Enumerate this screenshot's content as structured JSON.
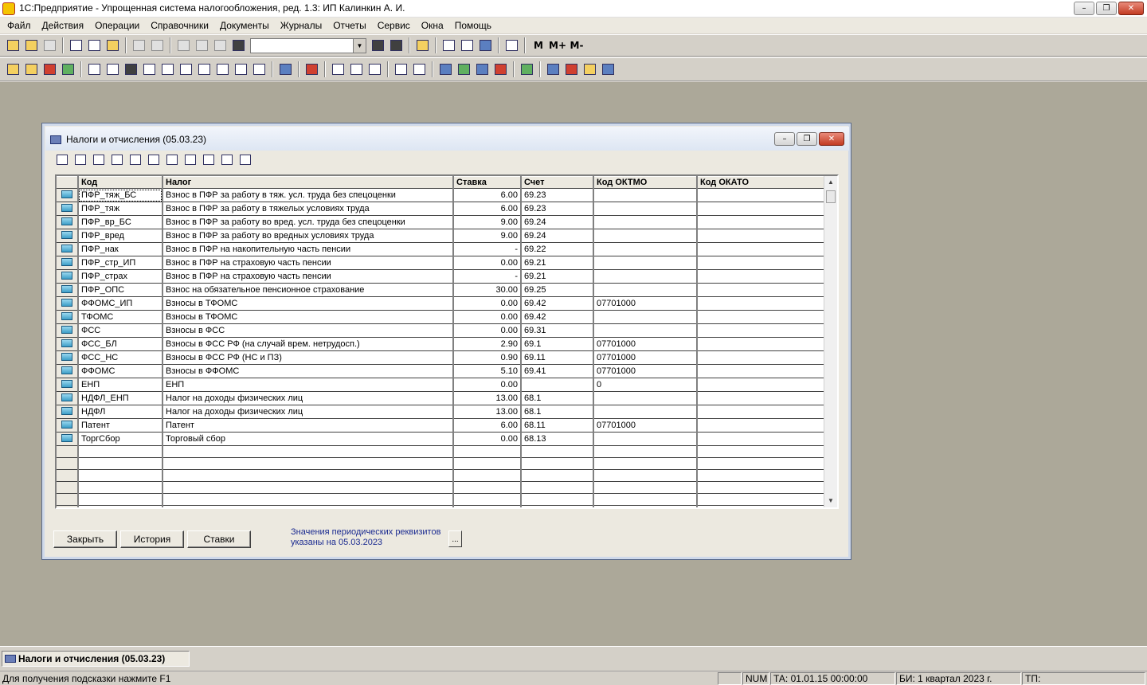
{
  "window": {
    "title": "1С:Предприятие - Упрощенная система налогообложения, ред. 1.3: ИП Калинкин А. И.",
    "minimize": "–",
    "restore": "❐",
    "close": "✕"
  },
  "menu": [
    "Файл",
    "Действия",
    "Операции",
    "Справочники",
    "Документы",
    "Журналы",
    "Отчеты",
    "Сервис",
    "Окна",
    "Помощь"
  ],
  "toolbar": {
    "memory_labels": [
      "M",
      "M+",
      "M-"
    ]
  },
  "child": {
    "title": "Налоги и отчисления (05.03.23)",
    "minimize": "–",
    "restore": "❐",
    "close": "✕"
  },
  "table": {
    "columns": [
      "Код",
      "Налог",
      "Ставка",
      "Счет",
      "Код ОКТМО",
      "Код ОКАТО"
    ],
    "rows": [
      {
        "code": "ПФР_тяж_БС",
        "name": "Взнос в ПФР за работу в тяж. усл. труда без спецоценки",
        "rate": "6.00",
        "account": "69.23",
        "oktmo": "",
        "okato": ""
      },
      {
        "code": "ПФР_тяж",
        "name": "Взнос в ПФР за работу в тяжелых условиях труда",
        "rate": "6.00",
        "account": "69.23",
        "oktmo": "",
        "okato": ""
      },
      {
        "code": "ПФР_вр_БС",
        "name": "Взнос в ПФР за работу во вред. усл. труда без спецоценки",
        "rate": "9.00",
        "account": "69.24",
        "oktmo": "",
        "okato": ""
      },
      {
        "code": "ПФР_вред",
        "name": "Взнос в ПФР за работу во вредных условиях труда",
        "rate": "9.00",
        "account": "69.24",
        "oktmo": "",
        "okato": ""
      },
      {
        "code": "ПФР_нак",
        "name": "Взнос в ПФР на накопительную часть пенсии",
        "rate": "-",
        "account": "69.22",
        "oktmo": "",
        "okato": ""
      },
      {
        "code": "ПФР_стр_ИП",
        "name": "Взнос в ПФР на страховую часть пенсии",
        "rate": "0.00",
        "account": "69.21",
        "oktmo": "",
        "okato": ""
      },
      {
        "code": "ПФР_страх",
        "name": "Взнос в ПФР на страховую часть пенсии",
        "rate": "-",
        "account": "69.21",
        "oktmo": "",
        "okato": ""
      },
      {
        "code": "ПФР_ОПС",
        "name": "Взнос на обязательное пенсионное страхование",
        "rate": "30.00",
        "account": "69.25",
        "oktmo": "",
        "okato": ""
      },
      {
        "code": "ФФОМС_ИП",
        "name": "Взносы в ТФОМС",
        "rate": "0.00",
        "account": "69.42",
        "oktmo": "07701000",
        "okato": ""
      },
      {
        "code": "ТФОМС",
        "name": "Взносы в ТФОМС",
        "rate": "0.00",
        "account": "69.42",
        "oktmo": "",
        "okato": ""
      },
      {
        "code": "ФСС",
        "name": "Взносы в ФСС",
        "rate": "0.00",
        "account": "69.31",
        "oktmo": "",
        "okato": ""
      },
      {
        "code": "ФСС_БЛ",
        "name": "Взносы в ФСС РФ (на случай врем. нетрудосп.)",
        "rate": "2.90",
        "account": "69.1",
        "oktmo": "07701000",
        "okato": ""
      },
      {
        "code": "ФСС_НС",
        "name": "Взносы в ФСС РФ (НС и ПЗ)",
        "rate": "0.90",
        "account": "69.11",
        "oktmo": "07701000",
        "okato": ""
      },
      {
        "code": "ФФОМС",
        "name": "Взносы в ФФОМС",
        "rate": "5.10",
        "account": "69.41",
        "oktmo": "07701000",
        "okato": ""
      },
      {
        "code": "ЕНП",
        "name": "ЕНП",
        "rate": "0.00",
        "account": "",
        "oktmo": "0",
        "okato": ""
      },
      {
        "code": "НДФЛ_ЕНП",
        "name": "Налог на доходы физических лиц",
        "rate": "13.00",
        "account": "68.1",
        "oktmo": "",
        "okato": ""
      },
      {
        "code": "НДФЛ",
        "name": "Налог на доходы физических лиц",
        "rate": "13.00",
        "account": "68.1",
        "oktmo": "",
        "okato": ""
      },
      {
        "code": "Патент",
        "name": "Патент",
        "rate": "6.00",
        "account": "68.11",
        "oktmo": "07701000",
        "okato": ""
      },
      {
        "code": "ТоргСбор",
        "name": "Торговый сбор",
        "rate": "0.00",
        "account": "68.13",
        "oktmo": "",
        "okato": ""
      }
    ],
    "empty_rows": 8
  },
  "buttons": {
    "close": "Закрыть",
    "history": "История",
    "rates": "Ставки",
    "dots": "..."
  },
  "note": {
    "line1": "Значения периодических реквизитов",
    "line2": "указаны на 05.03.2023"
  },
  "taskbar": {
    "item": "Налоги и отчисления (05.03.23)"
  },
  "status": {
    "hint": "Для получения подсказки нажмите F1",
    "num": "NUM",
    "ta": "ТА: 01.01.15  00:00:00",
    "bi": "БИ: 1 квартал 2023 г.",
    "tp": "ТП:"
  }
}
